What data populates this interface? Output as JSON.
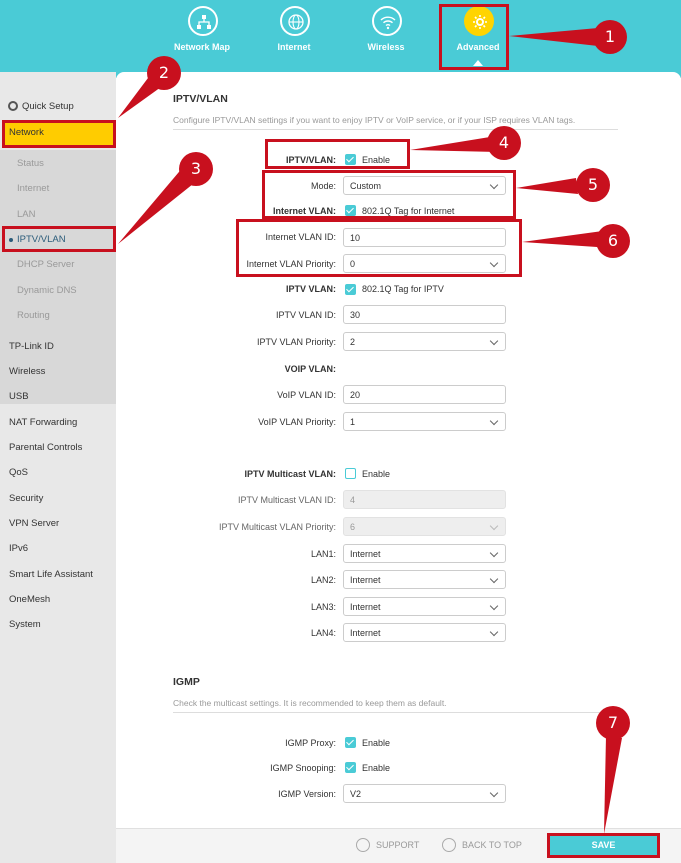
{
  "topnav": {
    "items": [
      {
        "label": "Network Map",
        "icon": "network-map-icon"
      },
      {
        "label": "Internet",
        "icon": "globe-icon"
      },
      {
        "label": "Wireless",
        "icon": "wifi-icon"
      },
      {
        "label": "Advanced",
        "icon": "gear-icon",
        "active": true
      }
    ]
  },
  "sidebar": {
    "quick_setup": "Quick Setup",
    "network": "Network",
    "network_sub": [
      "Status",
      "Internet",
      "LAN",
      "IPTV/VLAN",
      "DHCP Server",
      "Dynamic DNS",
      "Routing"
    ],
    "items": [
      "TP-Link ID",
      "Wireless",
      "USB",
      "NAT Forwarding",
      "Parental Controls",
      "QoS",
      "Security",
      "VPN Server",
      "IPv6",
      "Smart Life Assistant",
      "OneMesh",
      "System"
    ]
  },
  "iptv": {
    "title": "IPTV/VLAN",
    "desc": "Configure IPTV/VLAN settings if you want to enjoy IPTV or VoIP service, or if your ISP requires VLAN tags.",
    "iptv_vlan_label": "IPTV/VLAN:",
    "enable": "Enable",
    "mode_label": "Mode:",
    "mode_value": "Custom",
    "internet_vlan_label": "Internet VLAN:",
    "internet_tag": "802.1Q Tag for Internet",
    "internet_vlan_id_label": "Internet VLAN ID:",
    "internet_vlan_id": "10",
    "internet_vlan_priority_label": "Internet VLAN Priority:",
    "internet_vlan_priority": "0",
    "iptv_vlan_label2": "IPTV VLAN:",
    "iptv_tag": "802.1Q Tag for IPTV",
    "iptv_vlan_id_label": "IPTV VLAN ID:",
    "iptv_vlan_id": "30",
    "iptv_vlan_priority_label": "IPTV VLAN Priority:",
    "iptv_vlan_priority": "2",
    "voip_vlan_label": "VOIP VLAN:",
    "voip_vlan_id_label": "VoIP VLAN ID:",
    "voip_vlan_id": "20",
    "voip_vlan_priority_label": "VoIP VLAN Priority:",
    "voip_vlan_priority": "1",
    "multicast_label": "IPTV Multicast VLAN:",
    "multicast_enable": "Enable",
    "multicast_id_label": "IPTV Multicast VLAN ID:",
    "multicast_id": "4",
    "multicast_priority_label": "IPTV Multicast VLAN Priority:",
    "multicast_priority": "6",
    "lan1_label": "LAN1:",
    "lan1": "Internet",
    "lan2_label": "LAN2:",
    "lan2": "Internet",
    "lan3_label": "LAN3:",
    "lan3": "Internet",
    "lan4_label": "LAN4:",
    "lan4": "Internet"
  },
  "igmp": {
    "title": "IGMP",
    "desc": "Check the multicast settings. It is recommended to keep them as default.",
    "proxy_label": "IGMP Proxy:",
    "proxy_enable": "Enable",
    "snooping_label": "IGMP Snooping:",
    "snooping_enable": "Enable",
    "version_label": "IGMP Version:",
    "version": "V2"
  },
  "footer": {
    "support": "SUPPORT",
    "back_to_top": "BACK TO TOP",
    "save": "SAVE"
  },
  "annotations": [
    "1",
    "2",
    "3",
    "4",
    "5",
    "6",
    "7"
  ],
  "colors": {
    "accent": "#4acbd6",
    "annotation_red": "#c8101e",
    "highlight_yellow": "#ffcc00"
  }
}
